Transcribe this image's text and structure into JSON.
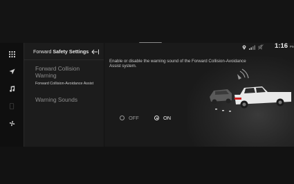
{
  "panel": {
    "title_prefix": "Forward ",
    "title_bold": "Safety Settings",
    "back_icon": "back-arrow-icon"
  },
  "list": {
    "items": [
      {
        "title": "Forward Collision Warning",
        "subtitle": "Forward Collision-Avoidance Assist"
      },
      {
        "title": "Warning Sounds"
      }
    ]
  },
  "rail": {
    "icons": [
      "apps-grid-icon",
      "navigation-arrow-icon",
      "music-note-icon",
      "phone-icon",
      "fan-icon"
    ]
  },
  "content": {
    "description": "Enable or disable the warning sound of the Forward Collision-Avoidance Assist system.",
    "options": [
      {
        "label": "OFF",
        "selected": false
      },
      {
        "label": "ON",
        "selected": true
      }
    ]
  },
  "status": {
    "time": "1:16",
    "ampm": "PM",
    "icons": [
      "location-icon",
      "signal-icon",
      "mute-icon"
    ]
  },
  "colors": {
    "background": "#121212",
    "panel": "#1c1c1c",
    "content": "#1a1a1a",
    "text_selected": "#f2f2f2",
    "text_muted": "#8d8d8d"
  }
}
